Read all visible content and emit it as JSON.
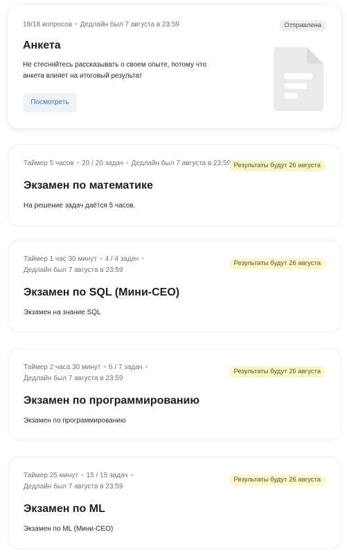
{
  "survey": {
    "meta": [
      "18/18 вопросов",
      "Дедлайн был 7 августа в 23:59"
    ],
    "badge": "Отправлена",
    "title": "Анкета",
    "description_line1": "Не стесняйтесь рассказывать о своем опыте, потому что",
    "description_line2": "анкета влияет на итоговый результат",
    "button_label": "Посмотреть",
    "icon": "document-icon"
  },
  "exams": [
    {
      "meta_line1": [
        "Таймер 5 часов",
        "20 / 20 задач",
        "Дедлайн был 7 августа в 23:59"
      ],
      "meta_line2": "",
      "badge": "Результаты будут 26 августа",
      "title": "Экзамен по математике",
      "description": "На решение задач даётся 5 часов."
    },
    {
      "meta_line1": [
        "Таймер 1 час 30 минут",
        "4 / 4 задач"
      ],
      "meta_line2": "Дедлайн был 7 августа в 23:59",
      "badge": "Результаты будут 26 августа",
      "title": "Экзамен по SQL (Мини-CEO)",
      "description": "Экзамен на знание SQL"
    },
    {
      "meta_line1": [
        "Таймер 2 часа 30 минут",
        "6 / 7 задач"
      ],
      "meta_line2": "Дедлайн был 7 августа в 23:59",
      "badge": "Результаты будут 26 августа",
      "title": "Экзамен по программированию",
      "description": "Экзамен по программированию"
    },
    {
      "meta_line1": [
        "Таймер 25 минут",
        "15 / 15 задач"
      ],
      "meta_line2": "Дедлайн был 7 августа в 23:59",
      "badge": "Результаты будут 26 августа",
      "title": "Экзамен по ML",
      "description": "Экзамен по ML (Мини-CEO)"
    }
  ],
  "colors": {
    "badge_sent_bg": "#efefef",
    "badge_wait_bg": "#fbf6c9",
    "button_text": "#3674b5",
    "icon_gray": "#ebebeb"
  }
}
